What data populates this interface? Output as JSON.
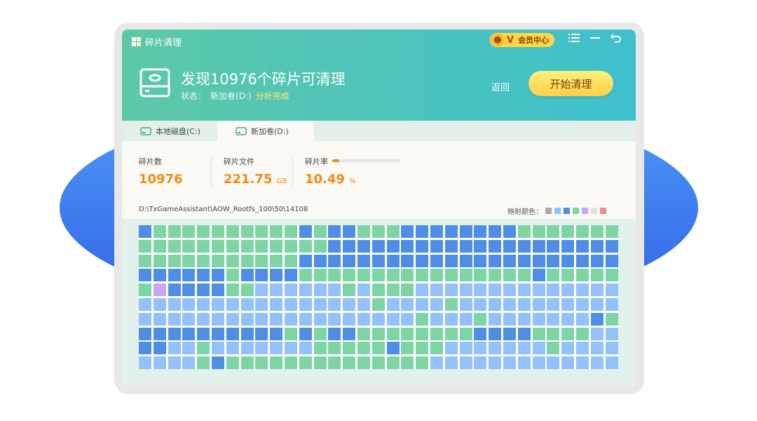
{
  "app": {
    "title": "碎片清理"
  },
  "vip": {
    "face_icon": "☻",
    "v": "V",
    "label": "会员中心"
  },
  "header": {
    "headline": "发现10976个碎片可清理",
    "status_label": "状态：",
    "status_volume": "新加卷(D:)",
    "status_state": "分析完成",
    "return_label": "返回",
    "start_label": "开始清理"
  },
  "tabs": [
    {
      "label": "本地磁盘(C:)"
    },
    {
      "label": "新加卷(D:)"
    }
  ],
  "stats": {
    "fragments_label": "碎片数",
    "fragments_value": "10976",
    "files_label": "碎片文件",
    "files_value": "221.75",
    "files_unit": "GB",
    "rate_label": "碎片率",
    "rate_value": "10.49",
    "rate_unit": "%",
    "rate_fraction": 0.1049
  },
  "path": "D:\\TxGameAssistant\\AOW_Rootfs_100\\50\\14108",
  "legend": {
    "label": "映射颜色：",
    "colors": [
      "#aaaaaa",
      "#93c1fb",
      "#4f8ee6",
      "#7cd5a3",
      "#c9a4f7",
      "#e0e0e0",
      "#f08c8c"
    ]
  },
  "colors": {
    "header_start": "#5cc8a6",
    "header_end": "#3ec0cd",
    "accent_orange": "#f28a17",
    "blob": "#3a74ee"
  },
  "map": {
    "palette": {
      "B": "#4f8ee6",
      "G": "#7cd5a3",
      "L": "#93c1fb",
      "P": "#c9a4f7"
    },
    "rows": [
      "BGGGGGGGGGGBGBBGGGBBBBBBBBGGGGGGG",
      "GGGGGGGGGGGGGBBBBBBBBBBBBBBBBBBBB",
      "GGGGGGGGGGGBBBBBBBBBBBBBBBBBBBBBB",
      "BBBBBBGBBBBGGGGGGGGGGGGGGGGBGGGGG",
      "GPBBBBGGLLLLLLGLGGGLLLLLLLLLLLLLL",
      "LLLLLLLLLLLLLLLLGLLLLGLLLLLLLLLLL",
      "LLLLLLLLLLLLLLLLLLLGLLLGLLLLLLLBG",
      "BBBBBBBBBBGBGBBGGGGGGGGBBBBGGGGLL",
      "BBLLGLLLLLLLGGGGGBGGGLLLLLLLGLLLL",
      "LLLLGBGGGGGGGGGGGGGGLLLLLLLLLLLLL"
    ]
  }
}
